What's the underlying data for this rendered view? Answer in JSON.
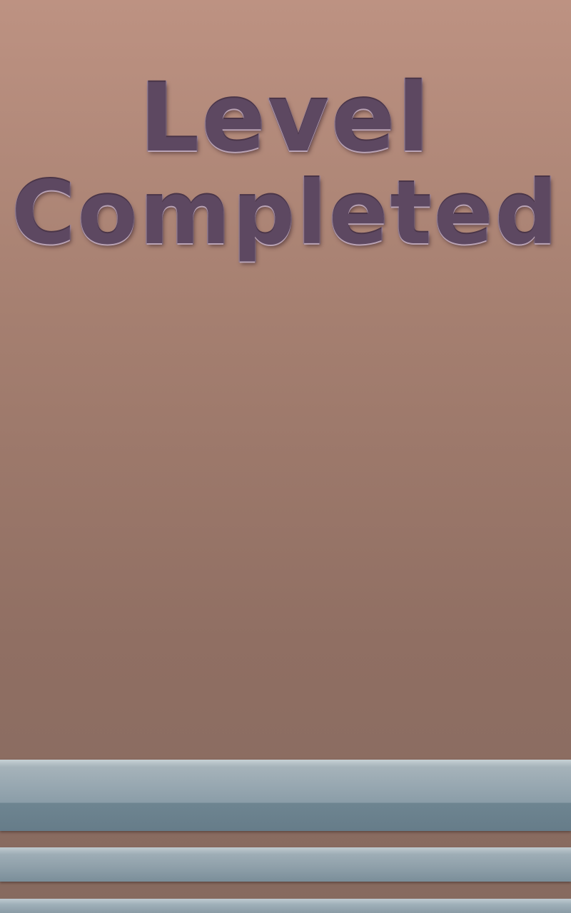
{
  "screen": {
    "title_line_1": "Level",
    "title_line_2": "Completed"
  },
  "colors": {
    "background_top": "#bd9282",
    "background_bottom": "#866a5f",
    "title_fill": "#5d4861",
    "title_outline": "#9a8498",
    "bar_light": "#c7d1d5",
    "bar_dark": "#667c89"
  }
}
